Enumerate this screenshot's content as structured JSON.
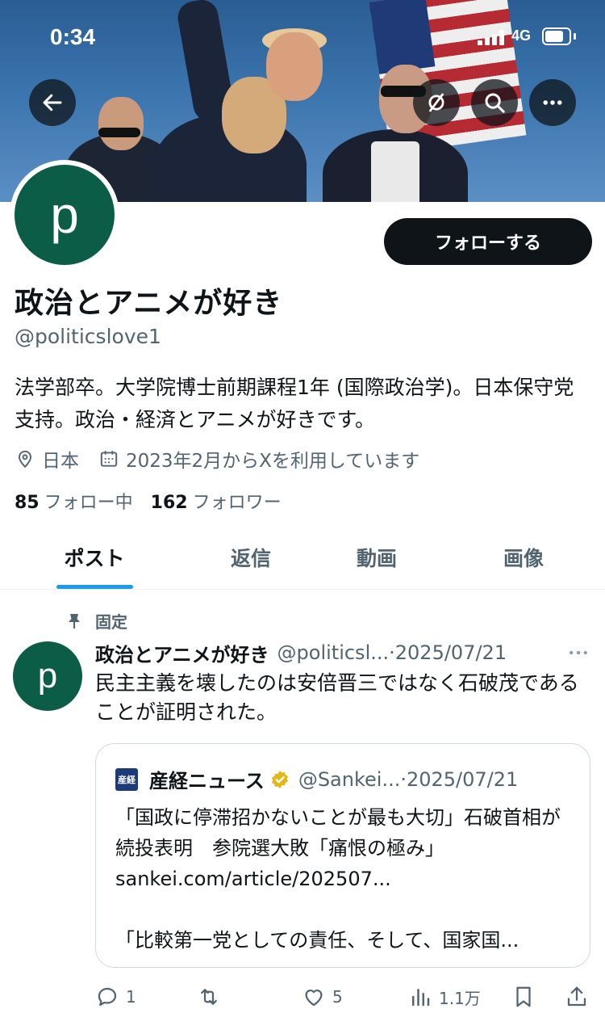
{
  "status_bar": {
    "time": "0:34",
    "network": "4G"
  },
  "profile": {
    "avatar_letter": "p",
    "follow_label": "フォローする",
    "display_name": "政治とアニメが好き",
    "handle": "@politicslove1",
    "bio": "法学部卒。大学院博士前期課程1年 (国際政治学)。日本保守党支持。政治・経済とアニメが好きです。",
    "location": "日本",
    "joined": "2023年2月からXを利用しています",
    "following_count": "85",
    "following_label": "フォロー中",
    "followers_count": "162",
    "followers_label": "フォロワー"
  },
  "tabs": [
    {
      "label": "ポスト",
      "active": true
    },
    {
      "label": "返信",
      "active": false
    },
    {
      "label": "動画",
      "active": false
    },
    {
      "label": "画像",
      "active": false
    }
  ],
  "post": {
    "pinned_label": "固定",
    "avatar_letter": "p",
    "author_name": "政治とアニメが好き",
    "author_handle": "@politicsl...",
    "date": "·2025/07/21",
    "text": "民主主義を壊したのは安倍晋三ではなく石破茂であることが証明された。",
    "quote": {
      "logo_text": "産経",
      "name": "産経ニュース",
      "handle": "@Sankei...",
      "date": "·2025/07/21",
      "text": "「国政に停滞招かないことが最も大切」石破首相が続投表明　参院選大敗「痛恨の極み」\nsankei.com/article/202507...\n\n「比較第一党としての責任、そして、国家国..."
    },
    "actions": {
      "replies": "1",
      "reposts": "",
      "likes": "5",
      "views": "1.1万"
    }
  },
  "colors": {
    "accent": "#1d9bf0",
    "avatar_bg": "#0b5d47",
    "text_primary": "#0f1419",
    "text_secondary": "#536471"
  }
}
